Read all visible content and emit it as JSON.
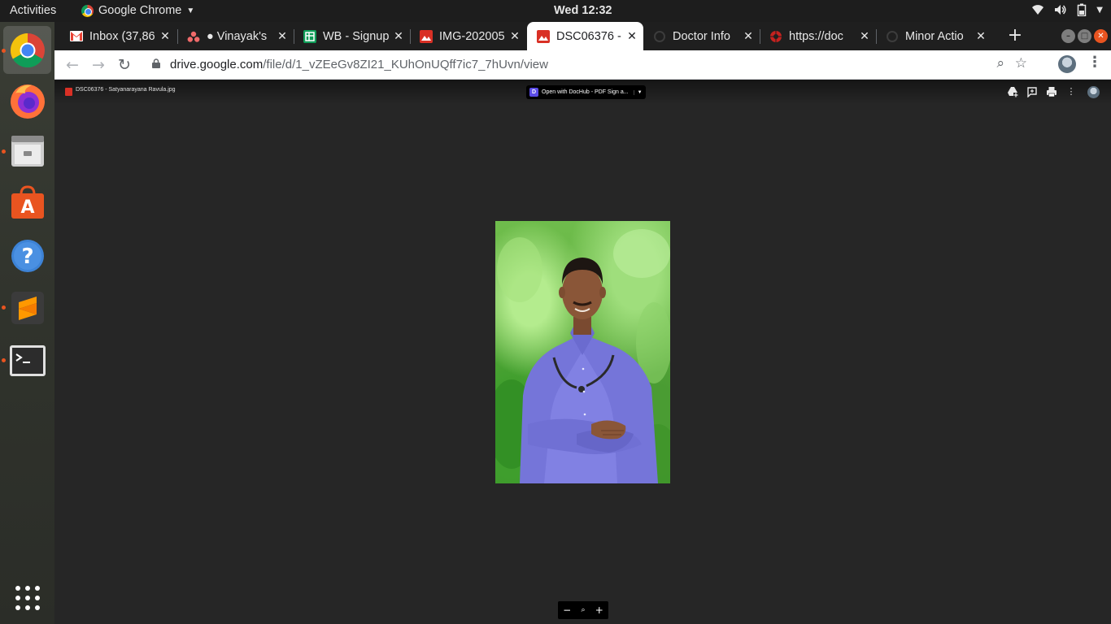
{
  "system_bar": {
    "activities": "Activities",
    "app_name": "Google Chrome",
    "clock": "Wed 12:32",
    "icons": [
      "wifi-icon",
      "volume-icon",
      "battery-icon",
      "power-menu-icon"
    ]
  },
  "dock": {
    "items": [
      {
        "name": "chrome",
        "icon": "chrome-icon",
        "running": true,
        "active": true
      },
      {
        "name": "firefox",
        "icon": "firefox-icon",
        "running": false
      },
      {
        "name": "files",
        "icon": "files-icon",
        "running": true
      },
      {
        "name": "software",
        "icon": "software-center-icon",
        "running": false
      },
      {
        "name": "help",
        "icon": "help-icon",
        "running": false
      },
      {
        "name": "sublime",
        "icon": "sublime-text-icon",
        "running": true
      },
      {
        "name": "terminal",
        "icon": "terminal-icon",
        "running": true
      }
    ],
    "apps_grid": "show-applications-icon"
  },
  "tabs": [
    {
      "title": "Inbox (37,86",
      "favicon": "gmail-icon",
      "color": "#ea4335"
    },
    {
      "title": "● Vinayak's",
      "favicon": "asana-icon",
      "color": "#f06a6a"
    },
    {
      "title": "WB - Signup",
      "favicon": "sheets-icon",
      "color": "#0f9d58"
    },
    {
      "title": "IMG-202005",
      "favicon": "image-icon",
      "color": "#d93025"
    },
    {
      "title": "DSC06376 -",
      "favicon": "image-icon",
      "color": "#d93025",
      "active": true
    },
    {
      "title": "Doctor Info",
      "favicon": "loading-icon",
      "color": "#3c3c3c"
    },
    {
      "title": "https://doc",
      "favicon": "doc-icon",
      "color": "#c5221f"
    },
    {
      "title": "Minor Actio",
      "favicon": "loading-icon",
      "color": "#3c3c3c"
    }
  ],
  "omnibox": {
    "host": "drive.google.com",
    "path": "/file/d/1_vZEeGv8ZI21_KUhOnUQff7ic7_7hUvn/view"
  },
  "viewer": {
    "file_name": "DSC06376 - Satyanarayana Ravula.jpg",
    "open_with": "Open with DocHub - PDF Sign a...",
    "dochub_letter": "D",
    "photo_alt": "DSC06376 - Satyanarayana Ravula.jpg",
    "zoom": {
      "minus": "−",
      "icon": "🔍",
      "plus": "+"
    }
  }
}
